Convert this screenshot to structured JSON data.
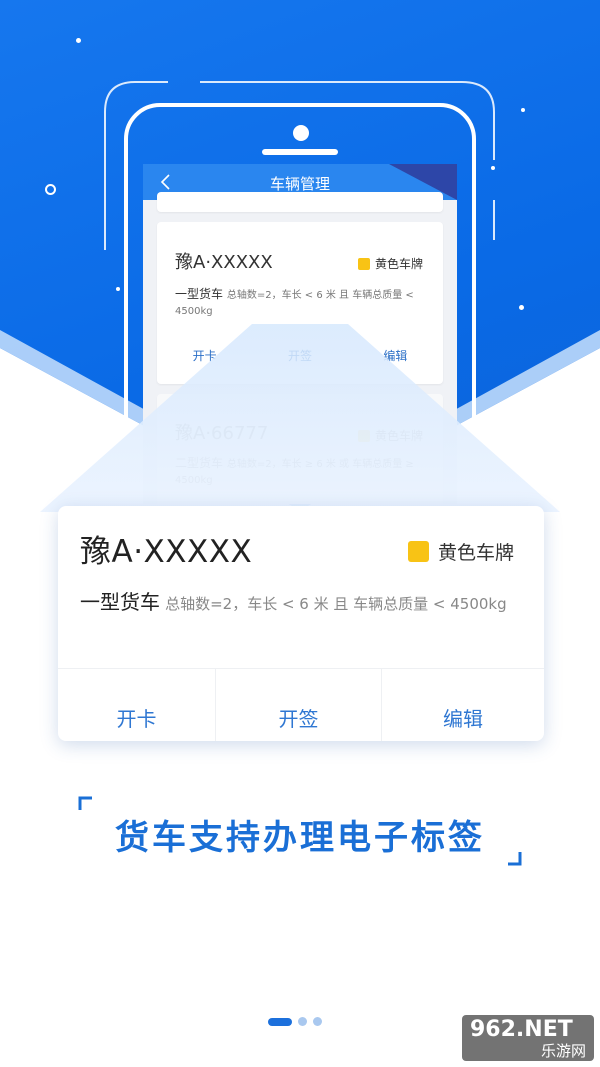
{
  "screen": {
    "title": "车辆管理"
  },
  "mini_cards": [
    {
      "plate": "豫A·XXXXX",
      "badge": "黄色车牌",
      "type": "一型货车",
      "spec": "总轴数=2，车长 < 6 米 且 车辆总质量 < 4500kg",
      "actions": [
        "开卡",
        "开签",
        "编辑"
      ]
    },
    {
      "plate": "豫A·66777",
      "badge": "黄色车牌",
      "type": "二型货车",
      "spec": "总轴数=2，车长 ≥ 6 米 或 车辆总质量 ≥ 4500kg"
    }
  ],
  "card": {
    "plate": "豫A·XXXXX",
    "badge": "黄色车牌",
    "type": "一型货车",
    "spec": "总轴数=2，车长 < 6 米 且 车辆总质量 < 4500kg",
    "actions": {
      "open_card": "开卡",
      "open_tag": "开签",
      "edit": "编辑"
    }
  },
  "slogan": "货车支持办理电子标签",
  "pager": {
    "current": 1,
    "total": 3
  },
  "watermark": {
    "top": "962.NET",
    "bottom": "乐游网"
  },
  "colors": {
    "primary_blue": "#1677ee",
    "plate_yellow": "#f8c315",
    "action_blue": "#2f77d2"
  }
}
